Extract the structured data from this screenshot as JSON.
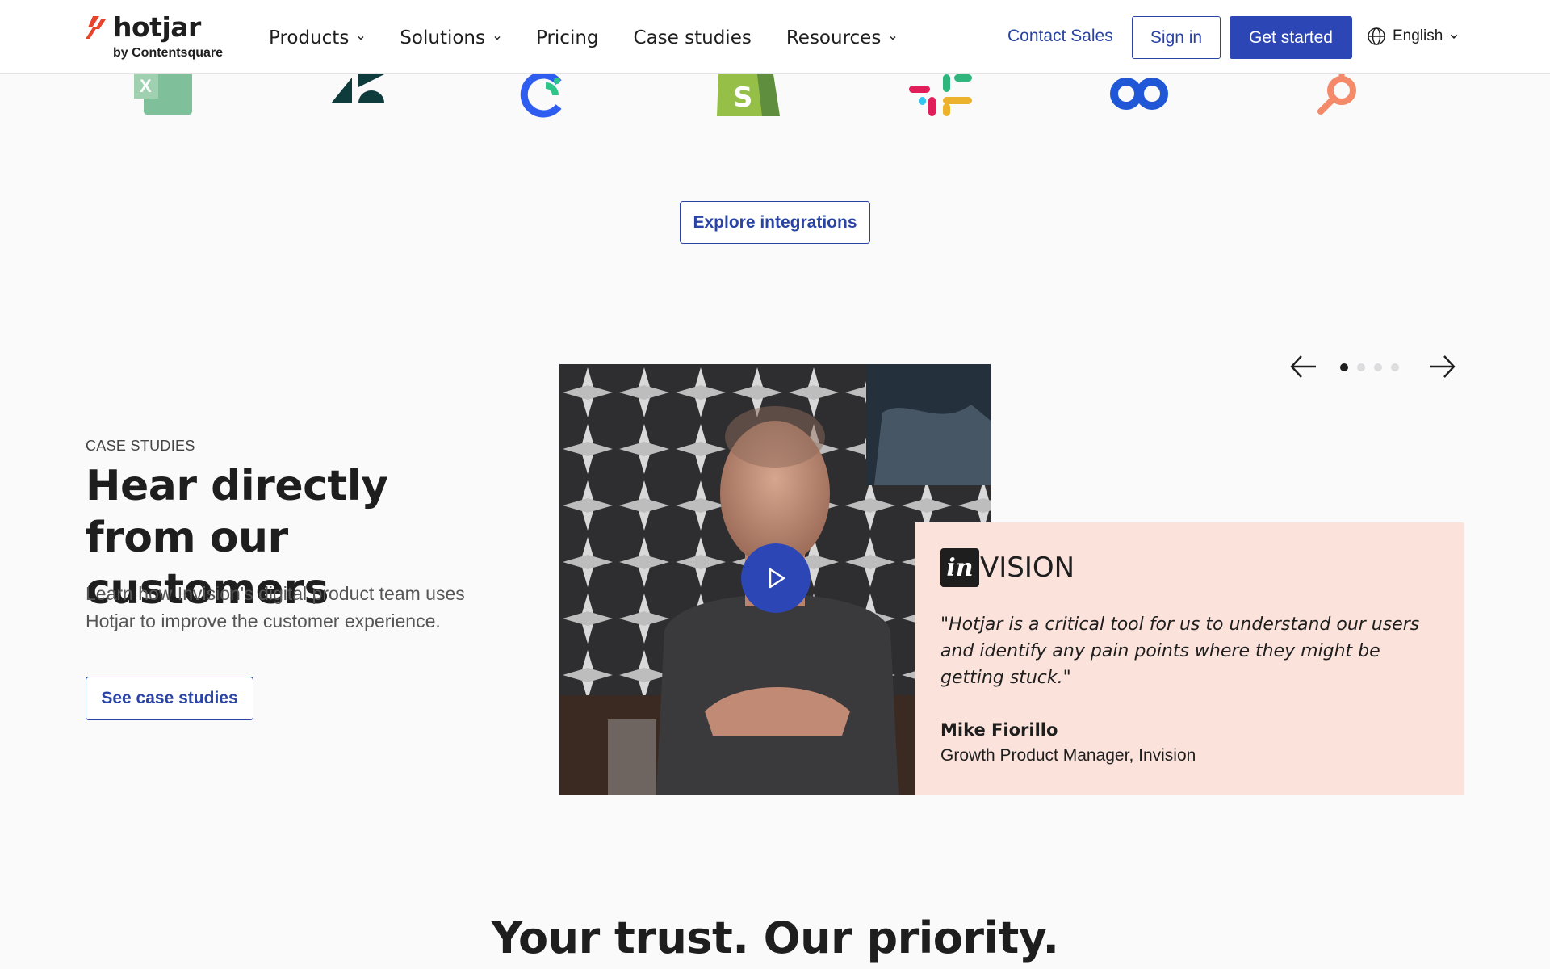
{
  "brand": {
    "name": "hotjar",
    "sub": "by Contentsquare",
    "accent": "#e8442c"
  },
  "nav": {
    "items": [
      {
        "label": "Products",
        "dropdown": true
      },
      {
        "label": "Solutions",
        "dropdown": true
      },
      {
        "label": "Pricing",
        "dropdown": false
      },
      {
        "label": "Case studies",
        "dropdown": false
      },
      {
        "label": "Resources",
        "dropdown": true
      }
    ],
    "contact_sales": "Contact Sales",
    "sign_in": "Sign in",
    "get_started": "Get started",
    "language": "English"
  },
  "integrations": {
    "logos": [
      "excel-logo",
      "zendesk-logo",
      "segment-logo",
      "shopify-logo",
      "slack-logo",
      "optimizely-logo",
      "hubspot-logo"
    ],
    "explore_label": "Explore integrations"
  },
  "case_studies": {
    "eyebrow": "CASE STUDIES",
    "headline": "Hear directly from our customers",
    "description": "Learn how Invision's digital product team uses Hotjar to improve the customer experience.",
    "cta": "See case studies",
    "carousel": {
      "total": 4,
      "active": 0
    },
    "testimonial": {
      "company_logo_box": "in",
      "company_logo_rest": "VISION",
      "quote": "\"Hotjar is a critical tool for us to understand our users and identify any pain points where they might be getting stuck.\"",
      "name": "Mike Fiorillo",
      "role": "Growth Product Manager, Invision"
    }
  },
  "trust_heading": "Your trust. Our priority.",
  "colors": {
    "primary": "#2c47b5",
    "link": "#2a44a6",
    "quote_bg": "#fbe3dc"
  }
}
